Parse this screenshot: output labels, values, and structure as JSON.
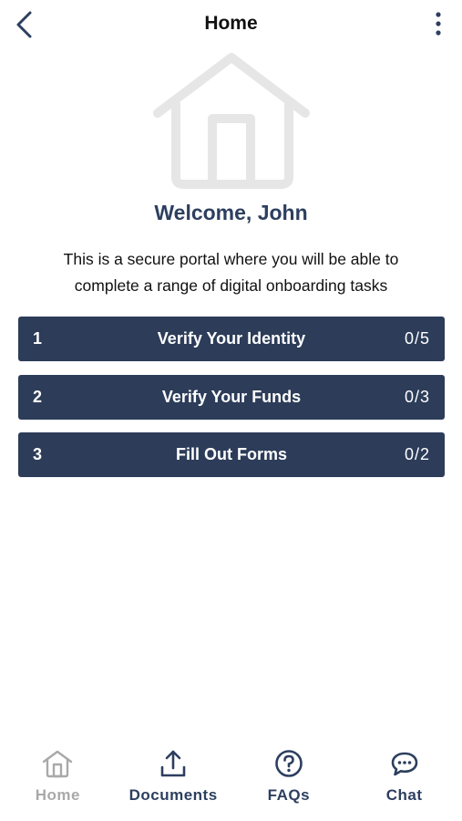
{
  "header": {
    "title": "Home",
    "back_icon": "chevron-left-icon",
    "more_icon": "more-vertical-icon"
  },
  "hero": {
    "icon": "house-icon",
    "welcome": "Welcome, John",
    "intro": "This is a secure portal where you will be able to complete a range of digital onboarding tasks"
  },
  "tasks": [
    {
      "number": "1",
      "label": "Verify Your Identity",
      "progress": "0/5"
    },
    {
      "number": "2",
      "label": "Verify Your Funds",
      "progress": "0/3"
    },
    {
      "number": "3",
      "label": "Fill Out Forms",
      "progress": "0/2"
    }
  ],
  "bottom_nav": [
    {
      "label": "Home",
      "icon": "home-icon",
      "active": true
    },
    {
      "label": "Documents",
      "icon": "upload-icon",
      "active": false
    },
    {
      "label": "FAQs",
      "icon": "question-circle-icon",
      "active": false
    },
    {
      "label": "Chat",
      "icon": "chat-bubble-icon",
      "active": false
    }
  ],
  "colors": {
    "primary": "#2c3c59",
    "heading": "#2d3f5f",
    "inactive_nav": "#a9a9a9",
    "hero_icon": "#e6e6e6"
  }
}
